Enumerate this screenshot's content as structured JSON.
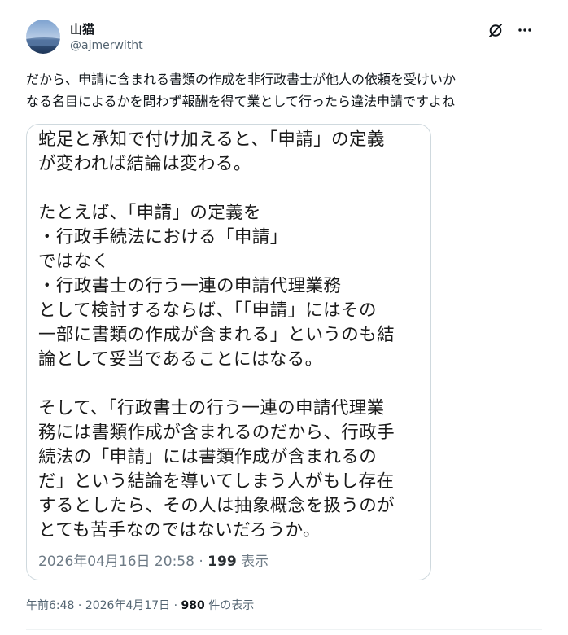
{
  "author": {
    "display_name": "山猫",
    "handle": "@ajmerwitht"
  },
  "header": {
    "grok_icon": "grok-slash-icon",
    "more_icon": "more-dots-icon"
  },
  "tweet": {
    "text": "だから、申請に含まれる書類の作成を非行政書士が他人の依頼を受けいか\nなる名目によるかを問わず報酬を得て業として行ったら違法申請ですよね"
  },
  "image_card": {
    "text": "蛇足と承知で付け加えると、「申請」の定義\nが変われば結論は変わる。\n\nたとえば、「申請」の定義を\n・行政手続法における「申請」\nではなく\n・行政書士の行う一連の申請代理業務\nとして検討するならば、「「申請」にはその\n一部に書類の作成が含まれる」というのも結\n論として妥当であることにはなる。\n\nそして、「行政書士の行う一連の申請代理業\n務には書類作成が含まれるのだから、行政手\n続法の「申請」には書類作成が含まれるの\nだ」という結論を導いてしまう人がもし存在\nするとしたら、その人は抽象概念を扱うのが\nとても苦手なのではないだろうか。",
    "date": "2026年04月16日 20:58",
    "separator": "·",
    "views_count": "199",
    "views_label": "表示"
  },
  "footer": {
    "time": "午前6:48",
    "separator1": "·",
    "date": "2026年4月17日",
    "separator2": "·",
    "views_count": "980",
    "views_label": "件の表示"
  },
  "colors": {
    "text_primary": "#0f1419",
    "text_secondary": "#536471",
    "border": "#cfd9de"
  }
}
